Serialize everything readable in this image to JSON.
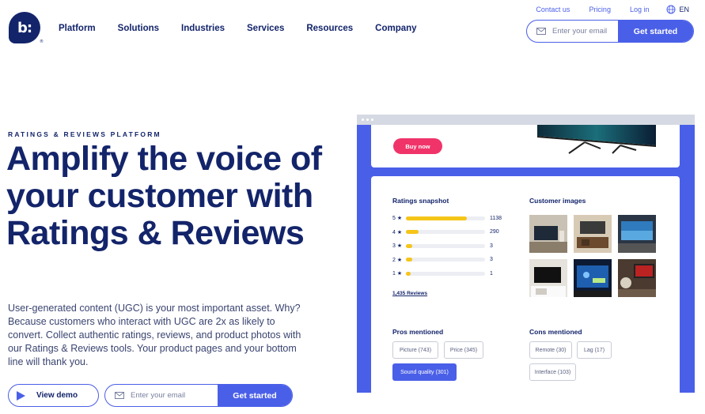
{
  "header": {
    "logo_text": "b:",
    "logo_mark": "®",
    "nav": [
      "Platform",
      "Solutions",
      "Industries",
      "Services",
      "Resources",
      "Company"
    ],
    "utility": {
      "contact": "Contact us",
      "pricing": "Pricing",
      "login": "Log in",
      "lang": "EN"
    },
    "email_placeholder": "Enter your email",
    "cta": "Get started"
  },
  "hero": {
    "eyebrow": "RATINGS & REVIEWS PLATFORM",
    "headline": "Amplify the voice of your customer with Ratings & Reviews",
    "body": "User-generated content (UGC) is your most important asset. Why? Because customers who interact with UGC are 2x as likely to convert. Collect authentic ratings, reviews, and product photos with our Ratings & Reviews tools. Your product pages and your bottom line will thank you.",
    "demo_label": "View demo",
    "email_placeholder": "Enter your email",
    "cta": "Get started"
  },
  "mockup": {
    "buy_label": "Buy now",
    "ratings_title": "Ratings snapshot",
    "ratings": [
      {
        "stars": "5 ★",
        "count": "1138",
        "fraction": 0.77
      },
      {
        "stars": "4 ★",
        "count": "290",
        "fraction": 0.16
      },
      {
        "stars": "3 ★",
        "count": "3",
        "fraction": 0.08
      },
      {
        "stars": "2 ★",
        "count": "3",
        "fraction": 0.08
      },
      {
        "stars": "1 ★",
        "count": "1",
        "fraction": 0.06
      }
    ],
    "reviews_link": "1,435 Reviews",
    "images_title": "Customer images",
    "pros_title": "Pros mentioned",
    "pros": [
      "Picture (743)",
      "Price (345)",
      "Sound quality (301)"
    ],
    "cons_title": "Cons mentioned",
    "cons": [
      "Remote (30)",
      "Lag (17)",
      "Interface (103)"
    ]
  },
  "colors": {
    "navy": "#13246a",
    "accent": "#4a5fe8",
    "buy": "#f0346a",
    "star": "#f5c518"
  }
}
